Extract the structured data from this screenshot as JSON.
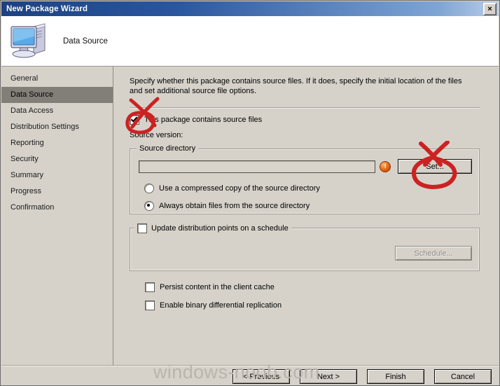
{
  "window": {
    "title": "New Package Wizard",
    "close_label": "×"
  },
  "header": {
    "icon": "computer-monitor-icon",
    "title": "Data Source"
  },
  "sidebar": {
    "items": [
      {
        "label": "General",
        "active": false
      },
      {
        "label": "Data Source",
        "active": true
      },
      {
        "label": "Data Access",
        "active": false
      },
      {
        "label": "Distribution Settings",
        "active": false
      },
      {
        "label": "Reporting",
        "active": false
      },
      {
        "label": "Security",
        "active": false
      },
      {
        "label": "Summary",
        "active": false
      },
      {
        "label": "Progress",
        "active": false
      },
      {
        "label": "Confirmation",
        "active": false
      }
    ]
  },
  "main": {
    "instructions": "Specify whether this package contains source files. If it does, specify the initial location of the files and set additional source file options.",
    "contains_source_files": {
      "label": "This package contains source files",
      "checked": true
    },
    "source_version_label": "Source version:",
    "source_directory_group": {
      "title": "Source directory",
      "path_value": "",
      "path_placeholder": "",
      "error_icon": "error-exclamation-icon",
      "set_button": "Set...",
      "radios": [
        {
          "label": "Use a compressed copy of the source directory",
          "selected": false
        },
        {
          "label": "Always obtain files from the source directory",
          "selected": true
        }
      ]
    },
    "update_schedule_group": {
      "label": "Update distribution points on a schedule",
      "checked": false,
      "schedule_button": "Schedule...",
      "schedule_disabled": true
    },
    "options": [
      {
        "label": "Persist content in the client cache",
        "checked": false
      },
      {
        "label": "Enable binary differential replication",
        "checked": false
      }
    ]
  },
  "footer": {
    "buttons": [
      {
        "label": "< Previous"
      },
      {
        "label": "Next >"
      },
      {
        "label": "Finish"
      },
      {
        "label": "Cancel"
      }
    ]
  },
  "watermark": {
    "text": "windows-noob.com"
  },
  "annotations": {
    "accent_color": "#cc2222",
    "marks": [
      {
        "name": "checkbox-circle-x",
        "target": "contains-source-files-checkbox"
      },
      {
        "name": "set-button-circle-x",
        "target": "set-button"
      }
    ]
  },
  "colors": {
    "window_bg": "#d6d2ca",
    "titlebar_start": "#1c4283",
    "titlebar_end": "#b9cde8",
    "sidebar_active_bg": "#827f79",
    "annotation_red": "#cc2222"
  }
}
